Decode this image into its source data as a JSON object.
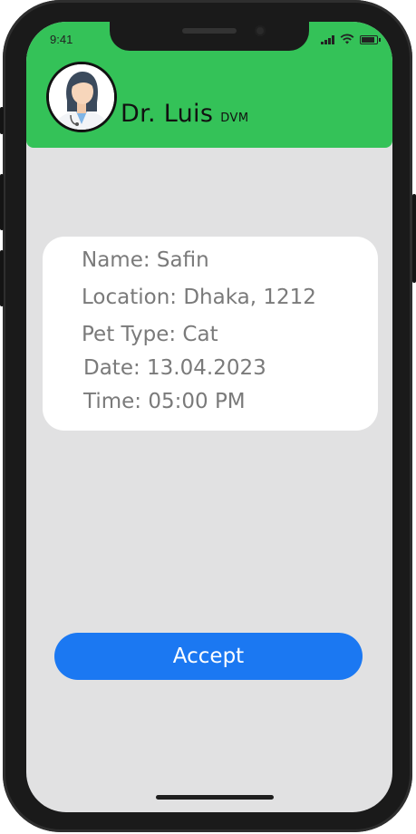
{
  "status_bar": {
    "time": "9:41"
  },
  "header": {
    "doctor_name": "Dr. Luis",
    "doctor_title": "DVM",
    "avatar_icon": "doctor-avatar-icon",
    "color": "#34c258"
  },
  "appointment": {
    "name": "Name: Safin",
    "location": "Location: Dhaka, 1212",
    "pet_type": "Pet Type: Cat",
    "date": "Date: 13.04.2023",
    "time": "Time: 05:00 PM"
  },
  "actions": {
    "accept_label": "Accept",
    "accept_color": "#1b78f2"
  }
}
